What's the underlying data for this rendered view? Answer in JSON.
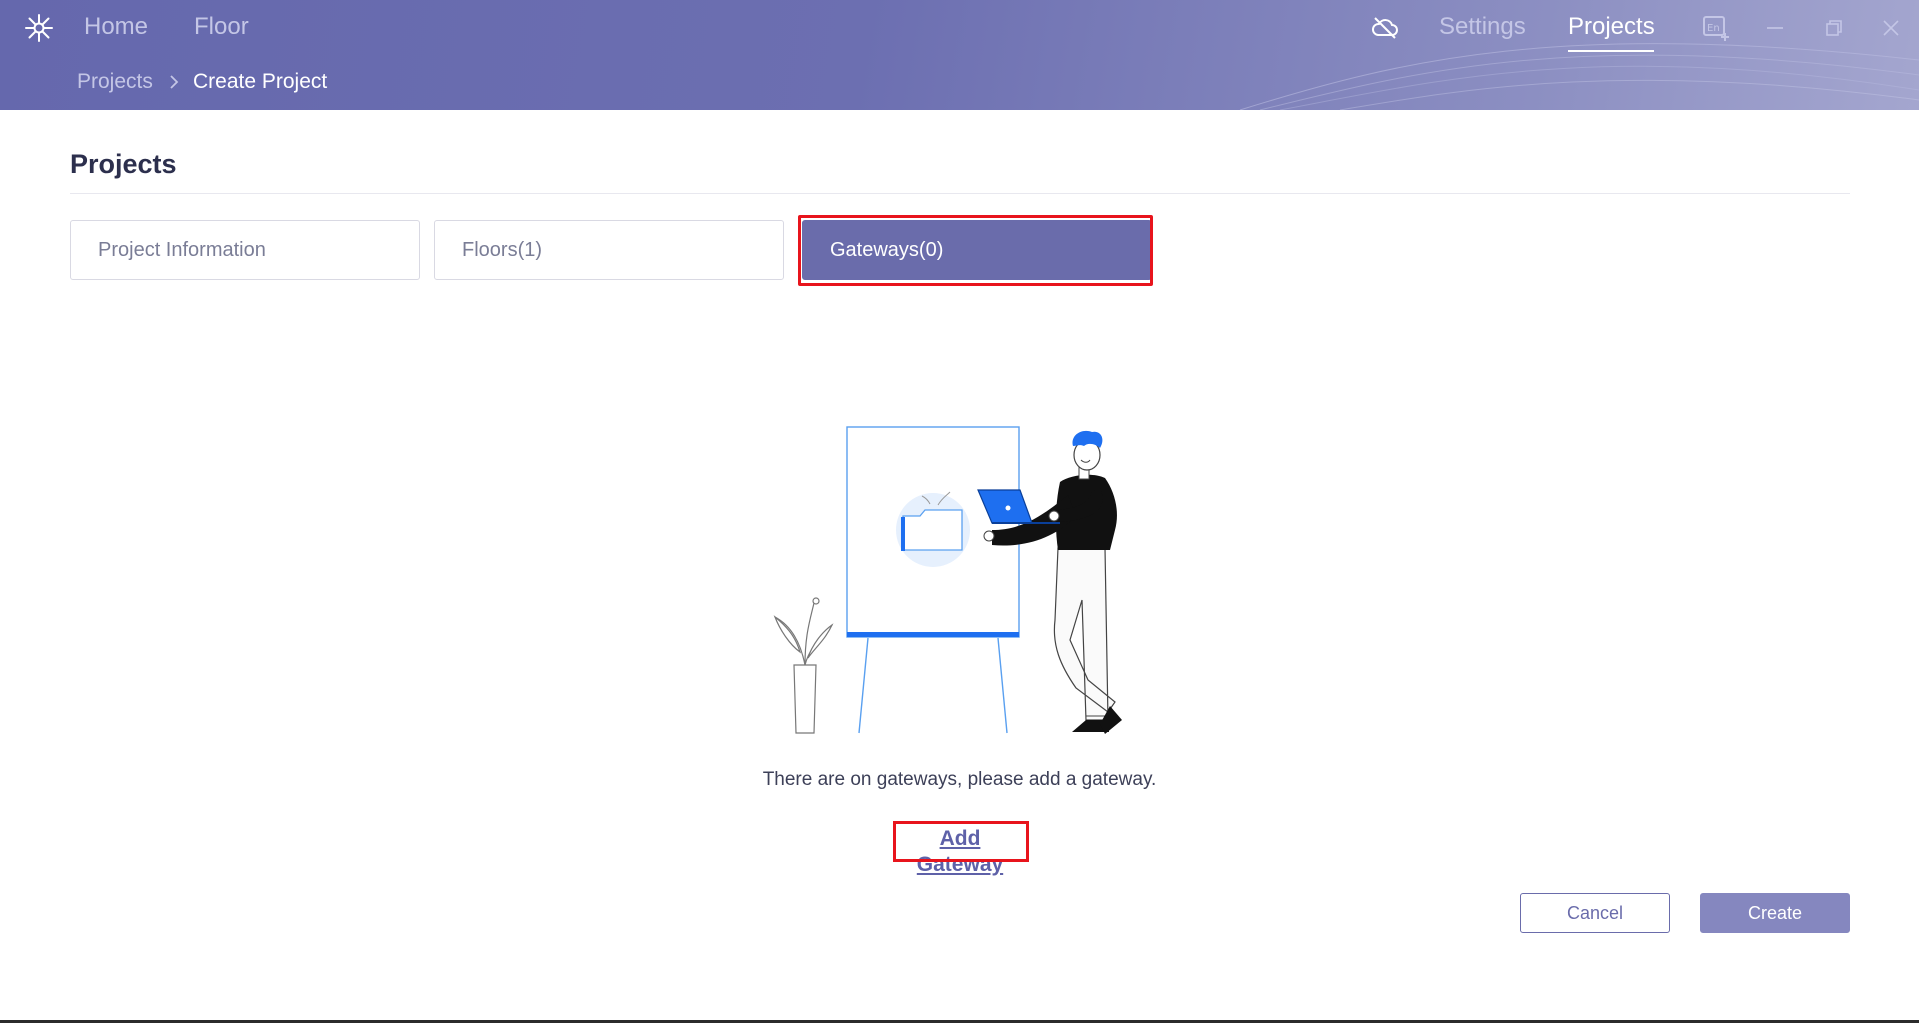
{
  "header": {
    "nav": {
      "home": "Home",
      "floor": "Floor",
      "settings": "Settings",
      "projects": "Projects"
    },
    "active_nav": "Projects",
    "icons": [
      "logo-icon",
      "cloud-off-icon",
      "language-icon",
      "minimize-icon",
      "restore-icon",
      "close-icon"
    ]
  },
  "breadcrumb": {
    "parent": "Projects",
    "current": "Create Project"
  },
  "page": {
    "title": "Projects"
  },
  "tabs": [
    {
      "label": "Project Information",
      "active": false
    },
    {
      "label": "Floors(1)",
      "active": false
    },
    {
      "label": "Gateways(0)",
      "active": true
    }
  ],
  "empty_state": {
    "message": "There are on gateways, please add a gateway.",
    "action": "Add Gateway"
  },
  "footer": {
    "cancel": "Cancel",
    "create": "Create"
  },
  "colors": {
    "accent": "#6a6cab",
    "header_gradient_start": "#6568ad",
    "highlight": "#e8141c",
    "illustration_blue": "#1e6ff0"
  }
}
